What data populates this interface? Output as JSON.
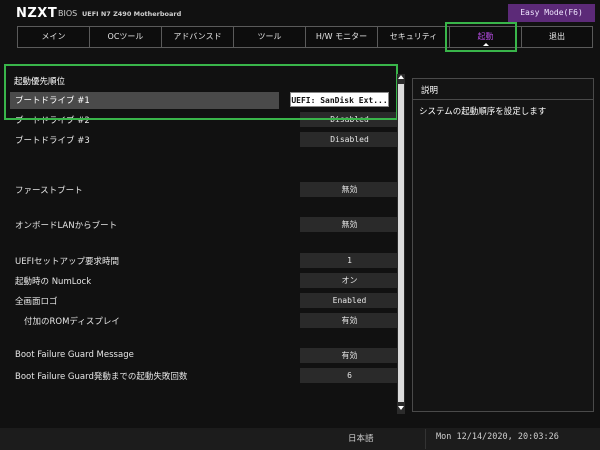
{
  "header": {
    "logo": "NZXT",
    "bios_label": "BIOS",
    "subtitle": "UEFI  N7 Z490 Motherboard",
    "easy_mode": "Easy Mode(F6)"
  },
  "tabs": [
    {
      "label": "メイン",
      "active": false
    },
    {
      "label": "OCツール",
      "active": false
    },
    {
      "label": "アドバンスド",
      "active": false
    },
    {
      "label": "ツール",
      "active": false
    },
    {
      "label": "H/W モニター",
      "active": false
    },
    {
      "label": "セキュリティ",
      "active": false
    },
    {
      "label": "起動",
      "active": true
    },
    {
      "label": "退出",
      "active": false
    }
  ],
  "main": {
    "section_title": "起動優先順位",
    "rows": [
      {
        "label": "ブートドライブ #1",
        "value": "UEFI: SanDisk Ext..."
      },
      {
        "label": "ブートドライブ #2",
        "value": "Disabled"
      },
      {
        "label": "ブートドライブ #3",
        "value": "Disabled"
      },
      {
        "label": "ファーストブート",
        "value": "無効"
      },
      {
        "label": "オンボードLANからブート",
        "value": "無効"
      },
      {
        "label": "UEFIセットアップ要求時間",
        "value": "1"
      },
      {
        "label": "起動時の NumLock",
        "value": "オン"
      },
      {
        "label": "全画面ロゴ",
        "value": "Enabled"
      },
      {
        "label": "付加のROMディスプレイ",
        "value": "有効"
      },
      {
        "label": "Boot Failure Guard Message",
        "value": "有効"
      },
      {
        "label": "Boot Failure Guard発動までの起動失敗回数",
        "value": "6"
      }
    ]
  },
  "help": {
    "title": "説明",
    "text": "システムの起動順序を設定します"
  },
  "footer": {
    "language": "日本語",
    "datetime": "Mon 12/14/2020, 20:03:26"
  },
  "colors": {
    "accent_purple": "#b44be0",
    "easy_mode_bg": "#5c2a78",
    "highlight_green": "#39b54a",
    "background": "#111111"
  }
}
